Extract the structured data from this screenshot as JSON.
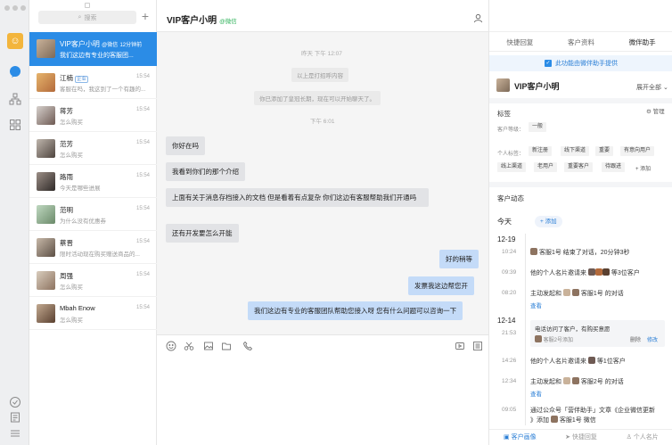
{
  "search": {
    "placeholder": "搜索"
  },
  "chats": [
    {
      "name": "VIP客户小明",
      "badge": "@微信",
      "time": "12分钟前",
      "preview": "我们这边有专业的客服团...",
      "active": true
    },
    {
      "name": "江楠",
      "badge": "企业",
      "time": "15:54",
      "preview": "客服在吗，我这到了一个有趣的..."
    },
    {
      "name": "蒋芳",
      "time": "15:54",
      "preview": "怎么购买"
    },
    {
      "name": "范芳",
      "time": "15:54",
      "preview": "怎么购买"
    },
    {
      "name": "路雨",
      "time": "15:54",
      "preview": "今天是哪些进展"
    },
    {
      "name": "范明",
      "time": "15:54",
      "preview": "为什么没有优惠券"
    },
    {
      "name": "蔡晋",
      "time": "15:54",
      "preview": "限时活动现在购买赠送商品的..."
    },
    {
      "name": "周强",
      "time": "15:54",
      "preview": "怎么购买"
    },
    {
      "name": "Mbah Enow",
      "time": "15:54",
      "preview": "怎么购买"
    }
  ],
  "chat": {
    "title": "VIP客户小明",
    "title_badge": "@微信",
    "sys1": "昨天 下午 12:07",
    "sys2": "以上是打招呼内容",
    "sys3": "你已添加了皇冠长期，现在可以开始聊天了。",
    "sys4": "下午 6:01",
    "messages": [
      {
        "dir": "in",
        "text": "你好在吗"
      },
      {
        "dir": "in",
        "text": "我看到你们的那个介绍"
      },
      {
        "dir": "in",
        "text": "上面有关于消息存档接入的文档 但是看着有点复杂 你们这边有客服帮助我们开通吗"
      },
      {
        "dir": "in",
        "text": "还有开发要怎么开能"
      },
      {
        "dir": "out",
        "text": "好的稍等"
      },
      {
        "dir": "out",
        "text": "发票我这边帮您开"
      },
      {
        "dir": "out",
        "text": "我们这边有专业的客服团队帮助您接入呀 您有什么问题可以咨询一下"
      }
    ]
  },
  "panel": {
    "tabs": [
      "快捷回复",
      "客户资料",
      "微伴助手"
    ],
    "active_tab": 2,
    "notice": "此功能由微伴助手提供",
    "customer_name": "VIP客户小明",
    "expand": "展开全部",
    "tags_title": "标签",
    "manage": "管理",
    "level_label": "客户等级：",
    "level_value": "一般",
    "personal_label": "个人标签：",
    "chips": [
      "新注册",
      "线下渠道",
      "重要",
      "有意向用户",
      "线上渠道",
      "老用户",
      "重要客户",
      "待跟进"
    ],
    "add_tag": "+ 添加",
    "dynamics_title": "客户动态",
    "today": "今天",
    "add_btn": "+ 添加",
    "timeline": [
      {
        "date": "12-19"
      },
      {
        "time": "10:24",
        "text": "客服1号 结束了对话，20分钟3秒"
      },
      {
        "time": "09:39",
        "text": "他的个人名片邀请来",
        "tail": "等3位客户"
      },
      {
        "time": "08:20",
        "text": "主动发起和",
        "tail": "客服1号 的对话",
        "link": "查看"
      },
      {
        "date": "12-14"
      },
      {
        "time": "21:53",
        "text": "电话访问了客户，有购买意愿",
        "sub": "客服2号添加",
        "actions": [
          "删除",
          "修改"
        ]
      },
      {
        "time": "14:26",
        "text": "他的个人名片邀请来",
        "tail": "等1位客户"
      },
      {
        "time": "12:34",
        "text": "主动发起和",
        "tail": "客服2号 的对话",
        "link": "查看"
      },
      {
        "time": "09:05",
        "text": "通过公众号「营伴助手」文章《企业微信更新",
        "text2": "》添加",
        "tail": "客服1号 微信"
      }
    ],
    "bottom": [
      "客户画像",
      "快捷回复",
      "个人名片"
    ]
  }
}
